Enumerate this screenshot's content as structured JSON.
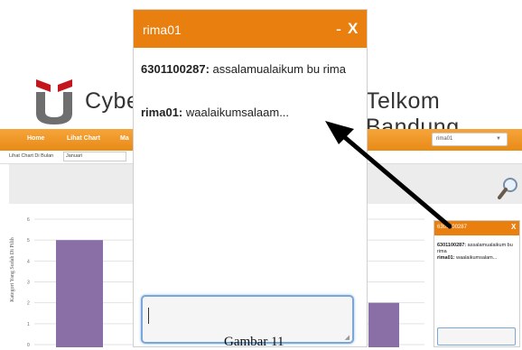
{
  "site": {
    "title_left": "Cybe",
    "title_right": "Telkom Bandung",
    "nav": [
      "Home",
      "Lihat Chart",
      "Ma"
    ],
    "user_select": "rima01",
    "filter_label": "Lihat Chart Di Bulan",
    "filter_value": "Januari",
    "y_axis_title": "Kategori Yang Sudah Di Pilih",
    "y_ticks": [
      "6",
      "5",
      "4",
      "3",
      "2",
      "1",
      "0"
    ]
  },
  "chart_data": {
    "type": "bar",
    "series": [
      {
        "values": [
          5,
          2
        ]
      }
    ],
    "ylim": [
      0,
      6
    ]
  },
  "chat": {
    "title": "rima01",
    "minimize": "-",
    "close": "X",
    "messages": [
      {
        "sender": "6301100287:",
        "text": "assalamualaikum bu rima"
      },
      {
        "sender": "rima01:",
        "text": "waalaikumsalaam..."
      }
    ]
  },
  "mini_chat": {
    "title": "6301100287",
    "close": "X",
    "messages": [
      {
        "sender": "6301100287:",
        "text": "assalamualaikum bu rima"
      },
      {
        "sender": "rima01:",
        "text": "waalaikumsalam..."
      }
    ]
  },
  "caption": "Gambar 11",
  "colors": {
    "accent": "#e97f0f",
    "bar": "#8a6ea6",
    "input_border": "#7aa7d6"
  }
}
